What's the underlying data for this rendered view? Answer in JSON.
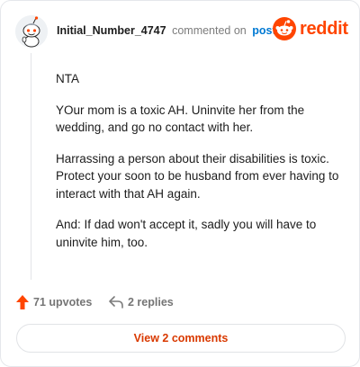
{
  "header": {
    "username": "Initial_Number_4747",
    "commented_text": "commented on",
    "post_link": "post",
    "brand_name": "reddit"
  },
  "comment": {
    "paragraphs": [
      "NTA",
      "YOur mom is a toxic AH. Uninvite her from the wedding, and go no contact with her.",
      "Harrassing a person about their disabilities is toxic. Protect your soon to be husband from ever having to interact with that AH again.",
      "And: If dad won't accept it, sadly you will have to uninvite him, too."
    ]
  },
  "actions": {
    "upvotes_label": "71 upvotes",
    "replies_label": "2 replies"
  },
  "footer": {
    "view_comments_label": "View 2 comments"
  },
  "colors": {
    "brand": "#ff4500",
    "link": "#0079d3",
    "upvote": "#ff4500",
    "view_button_text": "#d93900"
  },
  "icons": {
    "avatar": "snoo-avatar-icon",
    "brand": "reddit-logo-icon",
    "upvote": "upvote-arrow-icon",
    "reply": "reply-arrow-icon"
  }
}
